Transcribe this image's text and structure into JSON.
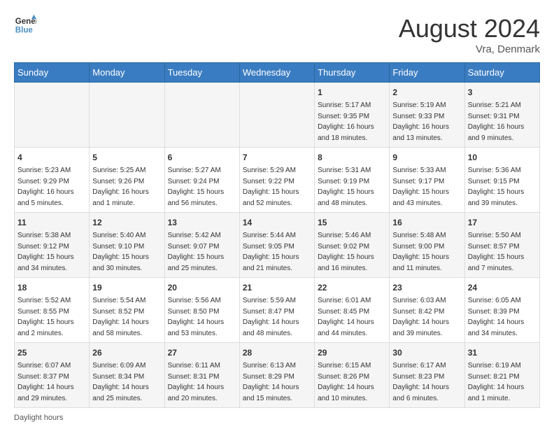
{
  "logo": {
    "line1": "General",
    "line2": "Blue"
  },
  "title": "August 2024",
  "location": "Vra, Denmark",
  "days_header": [
    "Sunday",
    "Monday",
    "Tuesday",
    "Wednesday",
    "Thursday",
    "Friday",
    "Saturday"
  ],
  "weeks": [
    [
      {
        "num": "",
        "info": ""
      },
      {
        "num": "",
        "info": ""
      },
      {
        "num": "",
        "info": ""
      },
      {
        "num": "",
        "info": ""
      },
      {
        "num": "1",
        "info": "Sunrise: 5:17 AM\nSunset: 9:35 PM\nDaylight: 16 hours\nand 18 minutes."
      },
      {
        "num": "2",
        "info": "Sunrise: 5:19 AM\nSunset: 9:33 PM\nDaylight: 16 hours\nand 13 minutes."
      },
      {
        "num": "3",
        "info": "Sunrise: 5:21 AM\nSunset: 9:31 PM\nDaylight: 16 hours\nand 9 minutes."
      }
    ],
    [
      {
        "num": "4",
        "info": "Sunrise: 5:23 AM\nSunset: 9:29 PM\nDaylight: 16 hours\nand 5 minutes."
      },
      {
        "num": "5",
        "info": "Sunrise: 5:25 AM\nSunset: 9:26 PM\nDaylight: 16 hours\nand 1 minute."
      },
      {
        "num": "6",
        "info": "Sunrise: 5:27 AM\nSunset: 9:24 PM\nDaylight: 15 hours\nand 56 minutes."
      },
      {
        "num": "7",
        "info": "Sunrise: 5:29 AM\nSunset: 9:22 PM\nDaylight: 15 hours\nand 52 minutes."
      },
      {
        "num": "8",
        "info": "Sunrise: 5:31 AM\nSunset: 9:19 PM\nDaylight: 15 hours\nand 48 minutes."
      },
      {
        "num": "9",
        "info": "Sunrise: 5:33 AM\nSunset: 9:17 PM\nDaylight: 15 hours\nand 43 minutes."
      },
      {
        "num": "10",
        "info": "Sunrise: 5:36 AM\nSunset: 9:15 PM\nDaylight: 15 hours\nand 39 minutes."
      }
    ],
    [
      {
        "num": "11",
        "info": "Sunrise: 5:38 AM\nSunset: 9:12 PM\nDaylight: 15 hours\nand 34 minutes."
      },
      {
        "num": "12",
        "info": "Sunrise: 5:40 AM\nSunset: 9:10 PM\nDaylight: 15 hours\nand 30 minutes."
      },
      {
        "num": "13",
        "info": "Sunrise: 5:42 AM\nSunset: 9:07 PM\nDaylight: 15 hours\nand 25 minutes."
      },
      {
        "num": "14",
        "info": "Sunrise: 5:44 AM\nSunset: 9:05 PM\nDaylight: 15 hours\nand 21 minutes."
      },
      {
        "num": "15",
        "info": "Sunrise: 5:46 AM\nSunset: 9:02 PM\nDaylight: 15 hours\nand 16 minutes."
      },
      {
        "num": "16",
        "info": "Sunrise: 5:48 AM\nSunset: 9:00 PM\nDaylight: 15 hours\nand 11 minutes."
      },
      {
        "num": "17",
        "info": "Sunrise: 5:50 AM\nSunset: 8:57 PM\nDaylight: 15 hours\nand 7 minutes."
      }
    ],
    [
      {
        "num": "18",
        "info": "Sunrise: 5:52 AM\nSunset: 8:55 PM\nDaylight: 15 hours\nand 2 minutes."
      },
      {
        "num": "19",
        "info": "Sunrise: 5:54 AM\nSunset: 8:52 PM\nDaylight: 14 hours\nand 58 minutes."
      },
      {
        "num": "20",
        "info": "Sunrise: 5:56 AM\nSunset: 8:50 PM\nDaylight: 14 hours\nand 53 minutes."
      },
      {
        "num": "21",
        "info": "Sunrise: 5:59 AM\nSunset: 8:47 PM\nDaylight: 14 hours\nand 48 minutes."
      },
      {
        "num": "22",
        "info": "Sunrise: 6:01 AM\nSunset: 8:45 PM\nDaylight: 14 hours\nand 44 minutes."
      },
      {
        "num": "23",
        "info": "Sunrise: 6:03 AM\nSunset: 8:42 PM\nDaylight: 14 hours\nand 39 minutes."
      },
      {
        "num": "24",
        "info": "Sunrise: 6:05 AM\nSunset: 8:39 PM\nDaylight: 14 hours\nand 34 minutes."
      }
    ],
    [
      {
        "num": "25",
        "info": "Sunrise: 6:07 AM\nSunset: 8:37 PM\nDaylight: 14 hours\nand 29 minutes."
      },
      {
        "num": "26",
        "info": "Sunrise: 6:09 AM\nSunset: 8:34 PM\nDaylight: 14 hours\nand 25 minutes."
      },
      {
        "num": "27",
        "info": "Sunrise: 6:11 AM\nSunset: 8:31 PM\nDaylight: 14 hours\nand 20 minutes."
      },
      {
        "num": "28",
        "info": "Sunrise: 6:13 AM\nSunset: 8:29 PM\nDaylight: 14 hours\nand 15 minutes."
      },
      {
        "num": "29",
        "info": "Sunrise: 6:15 AM\nSunset: 8:26 PM\nDaylight: 14 hours\nand 10 minutes."
      },
      {
        "num": "30",
        "info": "Sunrise: 6:17 AM\nSunset: 8:23 PM\nDaylight: 14 hours\nand 6 minutes."
      },
      {
        "num": "31",
        "info": "Sunrise: 6:19 AM\nSunset: 8:21 PM\nDaylight: 14 hours\nand 1 minute."
      }
    ]
  ],
  "footer": "Daylight hours"
}
